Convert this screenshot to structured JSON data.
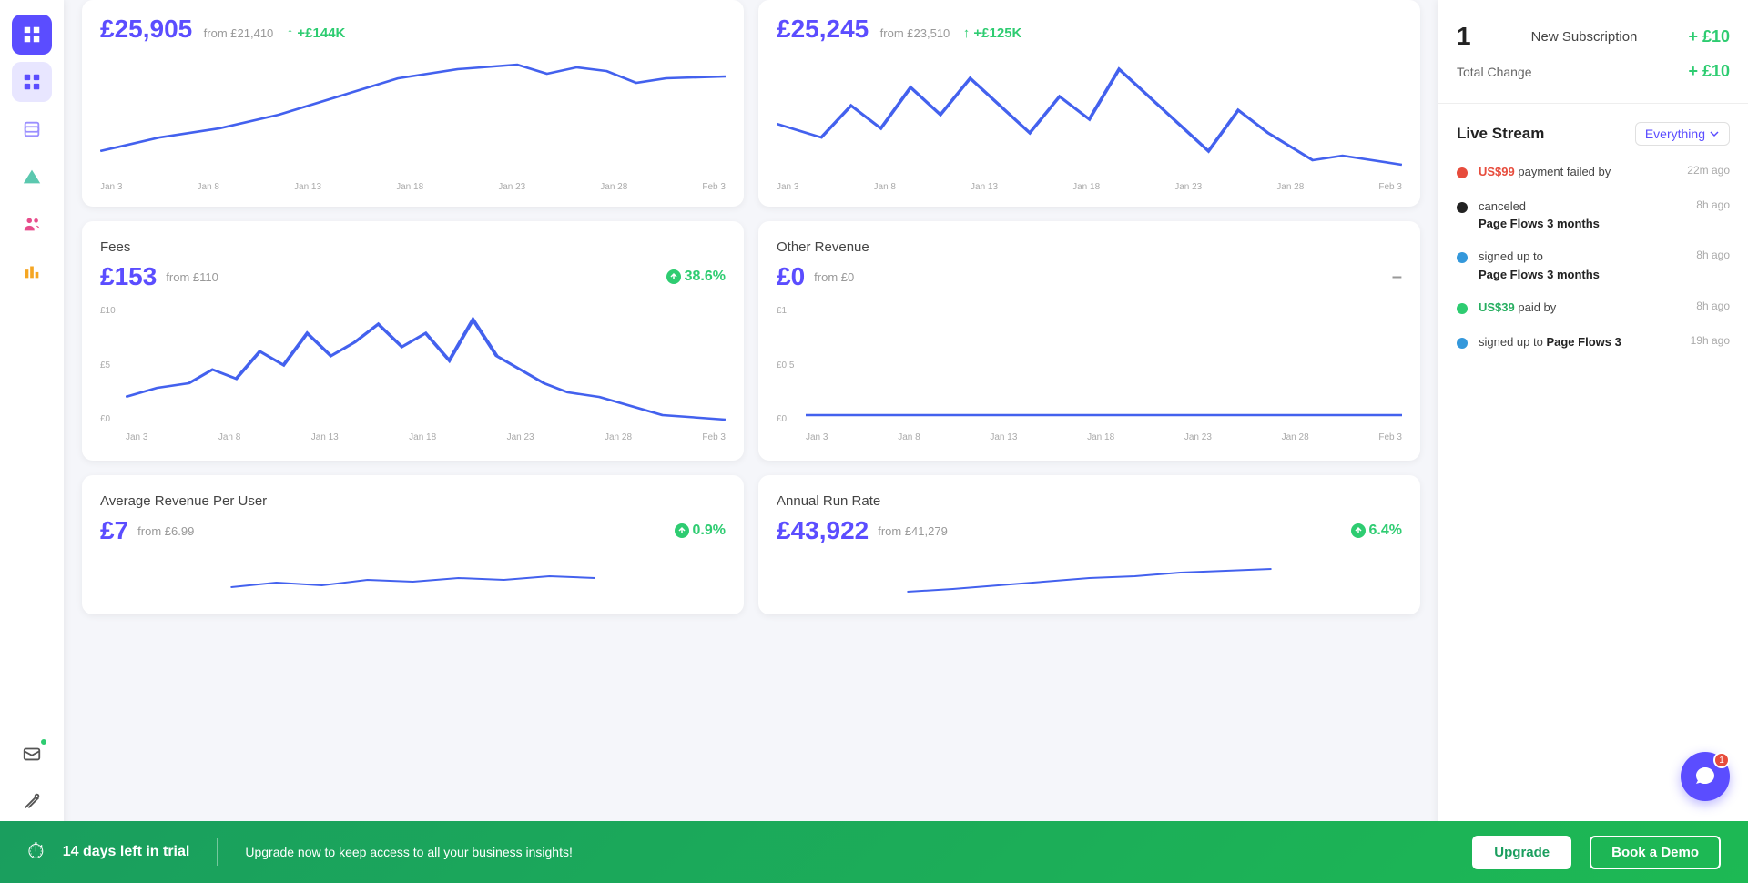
{
  "sidebar": {
    "icons": [
      {
        "name": "analytics-icon",
        "active": true,
        "symbol": "📊"
      },
      {
        "name": "grid-icon",
        "active": false,
        "symbol": "▦"
      },
      {
        "name": "layers-icon",
        "active": false,
        "symbol": "❏"
      },
      {
        "name": "triangle-icon",
        "active": false,
        "symbol": "▲"
      },
      {
        "name": "users-icon",
        "active": false,
        "symbol": "👥"
      },
      {
        "name": "bar-chart-icon",
        "active": false,
        "symbol": "📈"
      },
      {
        "name": "mail-icon",
        "active": false,
        "notification": true,
        "symbol": "✉"
      },
      {
        "name": "tools-icon",
        "active": false,
        "symbol": "✂"
      },
      {
        "name": "user-icon",
        "active": false,
        "symbol": "👤"
      }
    ]
  },
  "cards": [
    {
      "id": "fees",
      "title": "Fees",
      "value": "£153",
      "from": "from £110",
      "change": "38.6%",
      "change_direction": "up",
      "y_labels": [
        "£10",
        "£5",
        "£0"
      ]
    },
    {
      "id": "other-revenue",
      "title": "Other Revenue",
      "value": "£0",
      "from": "from £0",
      "change": "–",
      "change_direction": "neutral",
      "y_labels": [
        "£1",
        "£0.5",
        "£0"
      ]
    },
    {
      "id": "arpu",
      "title": "Average Revenue Per User",
      "value": "£7",
      "from": "from £6.99",
      "change": "0.9%",
      "change_direction": "up",
      "y_labels": []
    },
    {
      "id": "arr",
      "title": "Annual Run Rate",
      "value": "£43,922",
      "from": "from £41,279",
      "change": "6.4%",
      "change_direction": "up",
      "y_labels": []
    }
  ],
  "x_axis_labels": [
    "Jan 3",
    "Jan 8",
    "Jan 13",
    "Jan 18",
    "Jan 23",
    "Jan 28",
    "Feb 3"
  ],
  "top_cards": [
    {
      "value_prefix": "£",
      "value": "25,905",
      "from": "from £21,410",
      "change": "+£144K",
      "change_direction": "up"
    },
    {
      "value_prefix": "£",
      "value": "25,245",
      "from": "from £23,510",
      "change": "+£125K",
      "change_direction": "up"
    }
  ],
  "right_panel": {
    "subscription": {
      "count": "1",
      "label": "New Subscription",
      "amount": "+ £10",
      "total_label": "Total Change",
      "total_amount": "+ £10"
    },
    "live_stream": {
      "title": "Live Stream",
      "filter": "Everything",
      "events": [
        {
          "type": "red",
          "text_parts": [
            {
              "text": "US$99",
              "style": "highlight"
            },
            {
              "text": " payment failed by",
              "style": "normal"
            }
          ],
          "time": "22m ago"
        },
        {
          "type": "black",
          "text_parts": [
            {
              "text": "",
              "style": "normal"
            },
            {
              "text": " canceled",
              "style": "normal"
            }
          ],
          "sub": "Page Flows 3 months",
          "time": "8h ago"
        },
        {
          "type": "blue",
          "text_parts": [
            {
              "text": "",
              "style": "normal"
            },
            {
              "text": " signed up to",
              "style": "normal"
            }
          ],
          "sub": "Page Flows 3 months",
          "time": "8h ago"
        },
        {
          "type": "green",
          "text_parts": [
            {
              "text": "US$39",
              "style": "highlight-green"
            },
            {
              "text": " paid by",
              "style": "normal"
            }
          ],
          "time": "8h ago"
        },
        {
          "type": "blue",
          "text_parts": [
            {
              "text": "",
              "style": "normal"
            },
            {
              "text": " signed up to ",
              "style": "normal"
            },
            {
              "text": "Page Flows 3",
              "style": "bold"
            }
          ],
          "time": "19h ago"
        }
      ]
    }
  },
  "trial_bar": {
    "days_left": "14 days left in trial",
    "message": "Upgrade now to keep access to all your business insights!",
    "upgrade_label": "Upgrade",
    "demo_label": "Book a Demo"
  },
  "chat_badge": "1"
}
